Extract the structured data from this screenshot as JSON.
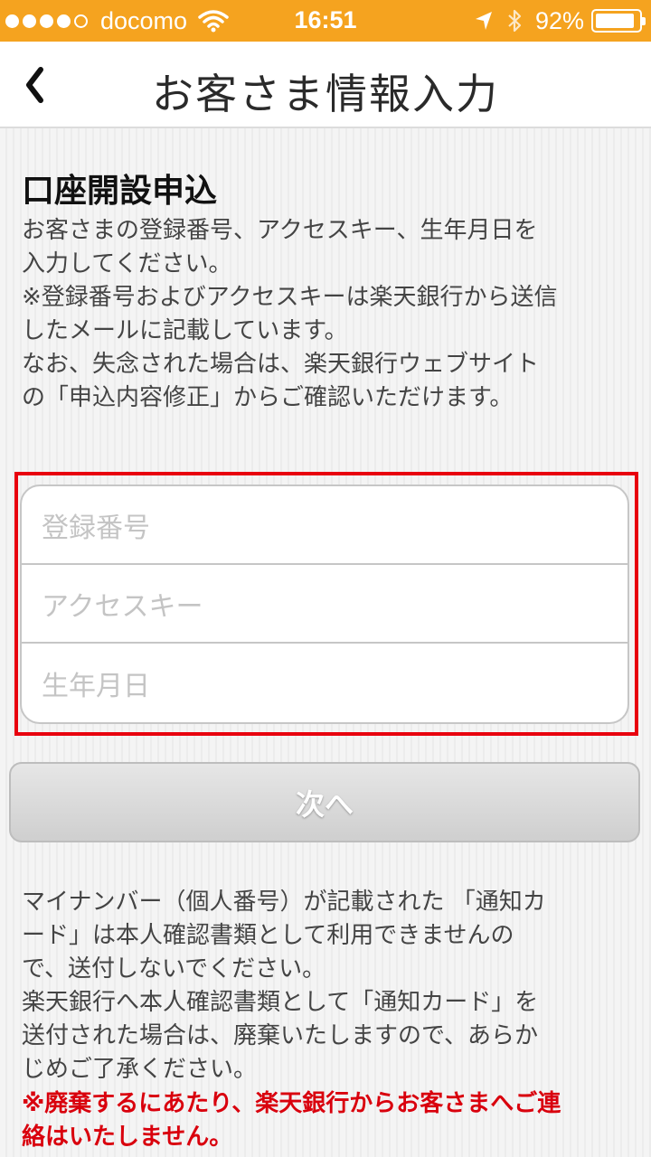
{
  "status_bar": {
    "carrier": "docomo",
    "time": "16:51",
    "battery_percent": "92%",
    "battery_level": 0.92,
    "signal_dots_filled": 4,
    "signal_dots_total": 5,
    "icons": [
      "wifi-icon",
      "location-arrow-icon",
      "bluetooth-icon",
      "battery-icon"
    ],
    "color": "#f5a31f"
  },
  "nav": {
    "back_icon": "chevron-left-icon",
    "title": "お客さま情報入力"
  },
  "section": {
    "title": "口座開設申込",
    "description_lines": [
      "お客さまの登録番号、アクセスキー、生年月日を",
      "入力してください。",
      "※登録番号およびアクセスキーは楽天銀行から送信",
      "したメールに記載しています。",
      "なお、失念された場合は、楽天銀行ウェブサイト",
      "の「申込内容修正」からご確認いただけます。"
    ]
  },
  "form": {
    "fields": [
      {
        "placeholder": "登録番号"
      },
      {
        "placeholder": "アクセスキー"
      },
      {
        "placeholder": "生年月日"
      }
    ],
    "highlight_color": "#e8000e"
  },
  "next_button": {
    "label": "次へ"
  },
  "notice": {
    "lines": [
      "マイナンバー（個人番号）が記載された 「通知カ",
      "ード」は本人確認書類として利用できませんの",
      "で、送付しないでください。",
      "楽天銀行へ本人確認書類として「通知カード」を",
      "送付された場合は、廃棄いたしますので、あらか",
      "じめご了承ください。"
    ],
    "warning_lines": [
      "※廃棄するにあたり、楽天銀行からお客さまへご連",
      "絡はいたしません。"
    ],
    "warning_color": "#d9000d"
  }
}
